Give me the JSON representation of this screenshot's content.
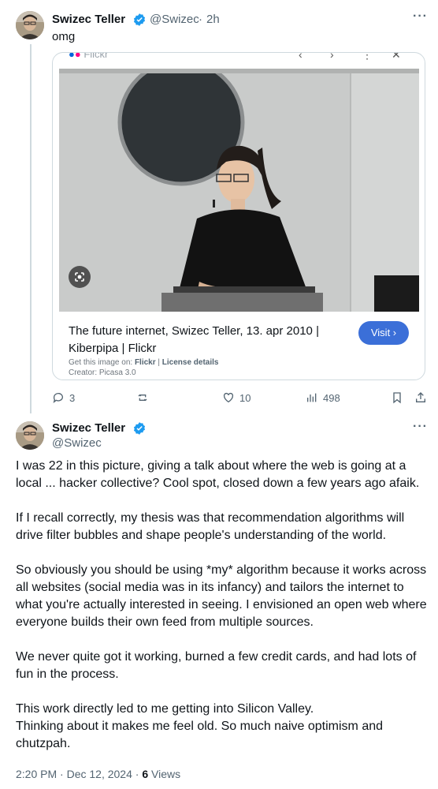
{
  "tweet1": {
    "name": "Swizec Teller",
    "handle": "@Swizec",
    "separator": "·",
    "time": "2h",
    "text": "omg",
    "card": {
      "site": "Flickr",
      "title": "The future internet, Swizec Teller, 13. apr 2010 | Kiberpipa | Flickr",
      "visit_label": "Visit",
      "get_image_label": "Get this image on:",
      "source": "Flickr",
      "license": "License details",
      "creator": "Creator: Picasa 3.0"
    },
    "actions": {
      "replies": "3",
      "likes": "10",
      "views": "498"
    }
  },
  "tweet2": {
    "name": "Swizec Teller",
    "handle": "@Swizec",
    "paragraphs": [
      "I was 22 in this picture, giving a talk about where the web is going at a local ... hacker collective? Cool spot, closed down a few years ago afaik.",
      "If I recall correctly, my thesis was that recommendation algorithms will drive filter bubbles and shape people's understanding of the world.",
      "So obviously you should be using *my* algorithm because it works across all websites (social media was in its infancy) and tailors the internet to what you're actually interested in seeing. I envisioned an open web where everyone builds their own feed from multiple sources.",
      "We never quite got it working, burned a few credit cards, and had lots of fun in the process.",
      "This work directly led to me getting into Silicon Valley."
    ],
    "last_line": "Thinking about it makes me feel old. So much naive optimism and chutzpah.",
    "timestamp": "2:20 PM · Dec 12, 2024 · ",
    "views_count": "6",
    "views_label": " Views"
  },
  "colors": {
    "verified": "#1d9bf0",
    "visit": "#3b6fd8",
    "muted": "#536471"
  }
}
